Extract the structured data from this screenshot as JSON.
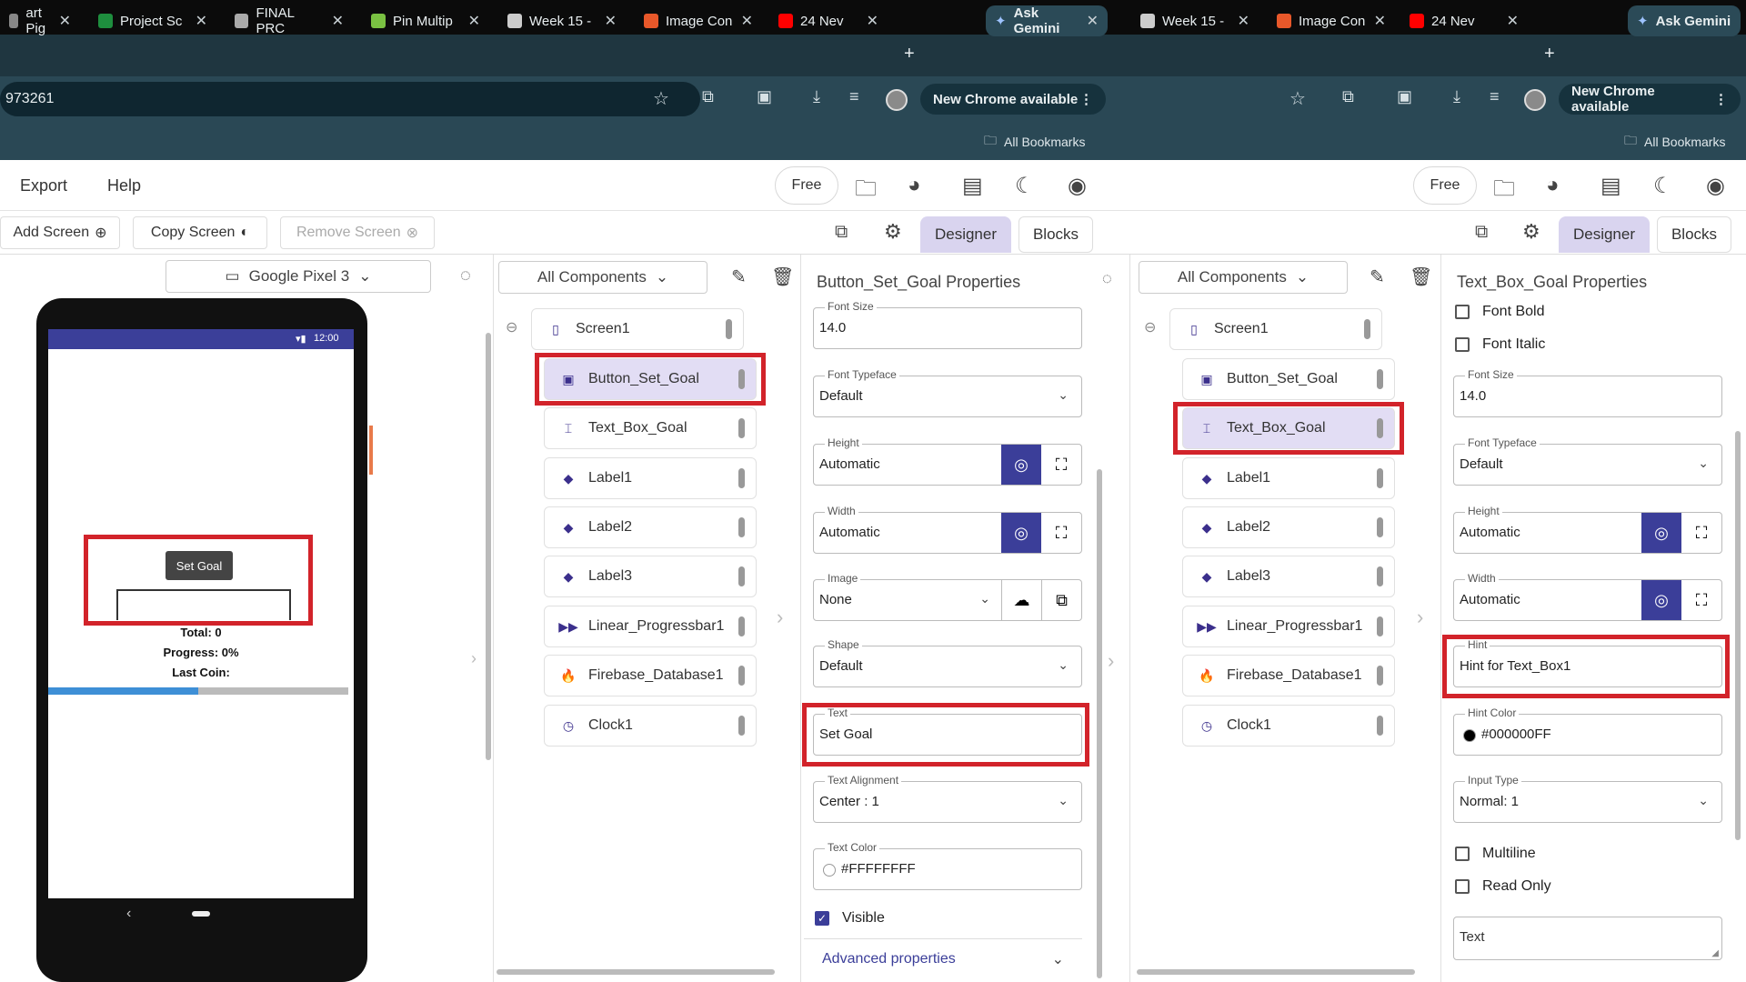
{
  "browser": {
    "tabs_left": [
      {
        "label": "art Pig",
        "icon": "page-icon",
        "color": "#888"
      },
      {
        "label": "Project Sc",
        "icon": "sheets-icon",
        "color": "#1e8e3e"
      },
      {
        "label": "FINAL PRC",
        "icon": "tree-icon",
        "color": "#aaa"
      },
      {
        "label": "Pin Multip",
        "icon": "s-icon",
        "color": "#7ac142"
      },
      {
        "label": "Week 15 -",
        "icon": "globe-icon",
        "color": "#ccc"
      },
      {
        "label": "Image Con",
        "icon": "media-icon",
        "color": "#e8582a"
      },
      {
        "label": "24 Nev",
        "icon": "youtube-icon",
        "color": "#ff0000"
      }
    ],
    "tabs_right": [
      {
        "label": "Week 15 -",
        "icon": "globe-icon",
        "color": "#ccc"
      },
      {
        "label": "Image Con",
        "icon": "media-icon",
        "color": "#e8582a"
      },
      {
        "label": "24 Nev",
        "icon": "youtube-icon",
        "color": "#ff0000"
      }
    ],
    "active_tab": "Ask Gemini",
    "active_tab_right": "Ask Gemini",
    "new_tab": "+",
    "url": "973261",
    "update_chip": "New Chrome available",
    "update_chip_right": "New Chrome available",
    "bookmarks": "All Bookmarks",
    "bookmarks_right": "All Bookmarks"
  },
  "app": {
    "menu": {
      "export": "Export",
      "help": "Help"
    },
    "plan": "Free",
    "plan_right": "Free",
    "add_screen": "Add Screen",
    "copy_screen": "Copy Screen",
    "remove_screen": "Remove Screen",
    "designer_tab": "Designer",
    "blocks_tab": "Blocks",
    "designer_tab_right": "Designer",
    "blocks_tab_right": "Blocks",
    "device": "Google Pixel 3",
    "components_filter": "All Components",
    "components_filter_right": "All Components"
  },
  "phone": {
    "time": "12:00",
    "button_label": "Set Goal",
    "total": "Total: 0",
    "progress": "Progress: 0%",
    "last_coin": "Last Coin:",
    "progress_fraction": 0.5
  },
  "tree_left": [
    {
      "label": "Screen1",
      "icon": "phone-icon"
    },
    {
      "label": "Button_Set_Goal",
      "icon": "button-icon"
    },
    {
      "label": "Text_Box_Goal",
      "icon": "textbox-icon"
    },
    {
      "label": "Label1",
      "icon": "label-icon"
    },
    {
      "label": "Label2",
      "icon": "label-icon"
    },
    {
      "label": "Label3",
      "icon": "label-icon"
    },
    {
      "label": "Linear_Progressbar1",
      "icon": "progress-icon"
    },
    {
      "label": "Firebase_Database1",
      "icon": "firebase-icon"
    },
    {
      "label": "Clock1",
      "icon": "clock-icon"
    }
  ],
  "tree_right": [
    {
      "label": "Screen1",
      "icon": "phone-icon"
    },
    {
      "label": "Button_Set_Goal",
      "icon": "button-icon"
    },
    {
      "label": "Text_Box_Goal",
      "icon": "textbox-icon"
    },
    {
      "label": "Label1",
      "icon": "label-icon"
    },
    {
      "label": "Label2",
      "icon": "label-icon"
    },
    {
      "label": "Label3",
      "icon": "label-icon"
    },
    {
      "label": "Linear_Progressbar1",
      "icon": "progress-icon"
    },
    {
      "label": "Firebase_Database1",
      "icon": "firebase-icon"
    },
    {
      "label": "Clock1",
      "icon": "clock-icon"
    }
  ],
  "props_left": {
    "title": "Button_Set_Goal Properties",
    "font_size_label": "Font Size",
    "font_size": "14.0",
    "font_typeface_label": "Font Typeface",
    "font_typeface": "Default",
    "height_label": "Height",
    "height": "Automatic",
    "width_label": "Width",
    "width": "Automatic",
    "image_label": "Image",
    "image": "None",
    "shape_label": "Shape",
    "shape": "Default",
    "text_label": "Text",
    "text": "Set Goal",
    "text_alignment_label": "Text Alignment",
    "text_alignment": "Center : 1",
    "text_color_label": "Text Color",
    "text_color": "#FFFFFFFF",
    "visible_label": "Visible",
    "advanced": "Advanced properties"
  },
  "props_right": {
    "title": "Text_Box_Goal Properties",
    "font_bold": "Font Bold",
    "font_italic": "Font Italic",
    "font_size_label": "Font Size",
    "font_size": "14.0",
    "font_typeface_label": "Font Typeface",
    "font_typeface": "Default",
    "height_label": "Height",
    "height": "Automatic",
    "width_label": "Width",
    "width": "Automatic",
    "hint_label": "Hint",
    "hint": "Hint for Text_Box1",
    "hint_color_label": "Hint Color",
    "hint_color": "#000000FF",
    "input_type_label": "Input Type",
    "input_type": "Normal: 1",
    "multiline": "Multiline",
    "read_only": "Read Only",
    "text_placeholder": "Text"
  },
  "colors": {
    "accent": "#3b3e99",
    "highlight": "#d2232a",
    "selected": "#e2ddf4"
  }
}
